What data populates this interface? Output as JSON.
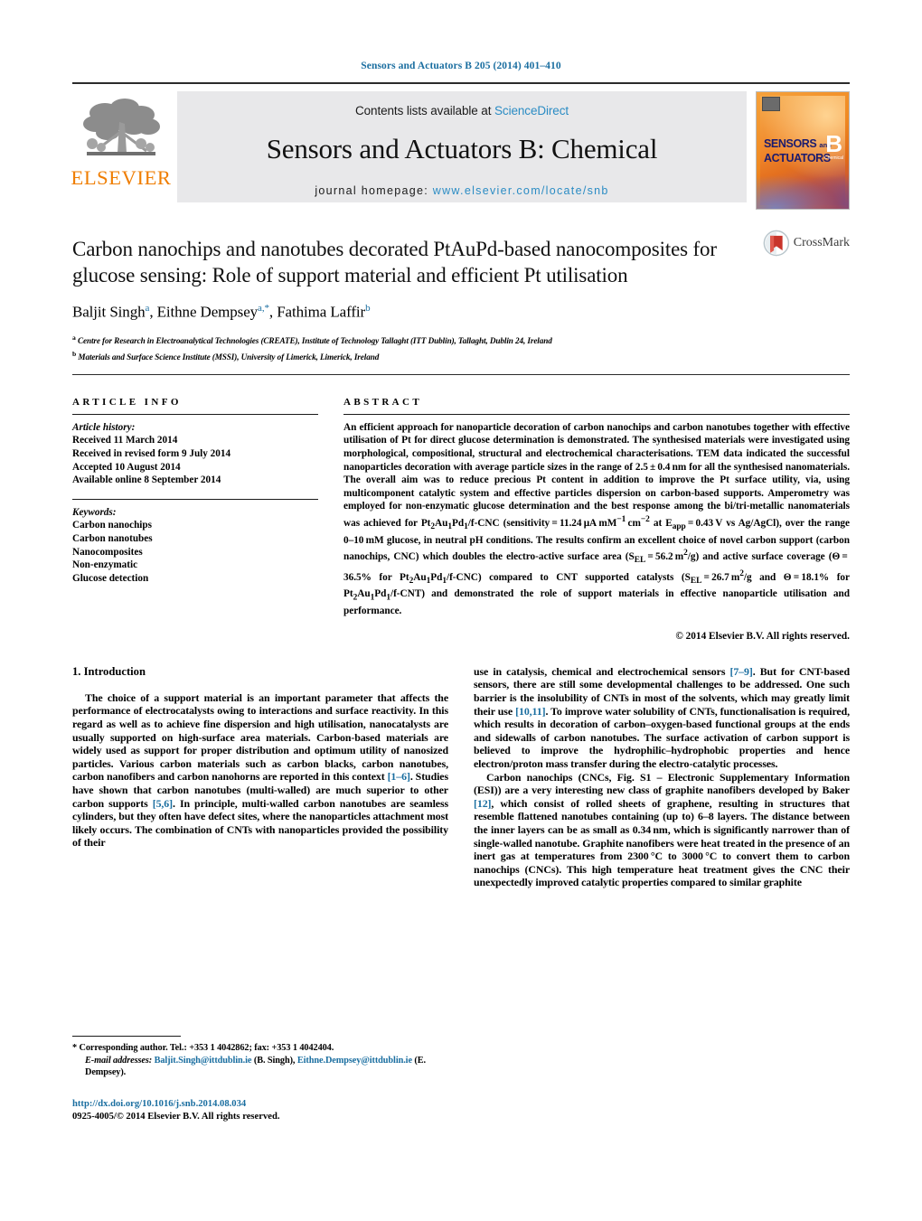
{
  "running_head": "Sensors and Actuators B 205 (2014) 401–410",
  "masthead": {
    "publisher_name": "ELSEVIER",
    "contents_prefix": "Contents lists available at ",
    "contents_link": "ScienceDirect",
    "journal_title": "Sensors and Actuators B: Chemical",
    "homepage_label": "journal homepage:",
    "homepage_url": "www.elsevier.com/locate/snb",
    "cover": {
      "line1": "SENSORS",
      "line1_small": "and",
      "line2": "ACTUATORS",
      "letter": "B",
      "sub": "Chemical"
    }
  },
  "article": {
    "title": "Carbon nanochips and nanotubes decorated PtAuPd-based nanocomposites for glucose sensing: Role of support material and efficient Pt utilisation",
    "crossmark_label": "CrossMark",
    "authors_html": "Baljit Singh<sup>a</sup>, Eithne Dempsey<sup>a,*</sup>, Fathima Laffir<sup>b</sup>",
    "affiliations": [
      "a Centre for Research in Electroanalytical Technologies (CREATE), Institute of Technology Tallaght (ITT Dublin), Tallaght, Dublin 24, Ireland",
      "b Materials and Surface Science Institute (MSSI), University of Limerick, Limerick, Ireland"
    ]
  },
  "article_info": {
    "heading": "ARTICLE INFO",
    "history_label": "Article history:",
    "history": [
      "Received 11 March 2014",
      "Received in revised form 9 July 2014",
      "Accepted 10 August 2014",
      "Available online 8 September 2014"
    ],
    "keywords_label": "Keywords:",
    "keywords": [
      "Carbon nanochips",
      "Carbon nanotubes",
      "Nanocomposites",
      "Non-enzymatic",
      "Glucose detection"
    ]
  },
  "abstract": {
    "heading": "ABSTRACT",
    "text_html": "An efficient approach for nanoparticle decoration of carbon nanochips and carbon nanotubes together with effective utilisation of Pt for direct glucose determination is demonstrated. The synthesised materials were investigated using morphological, compositional, structural and electrochemical characterisations. TEM data indicated the successful nanoparticles decoration with average particle sizes in the range of 2.5 ± 0.4 nm for all the synthesised nanomaterials. The overall aim was to reduce precious Pt content in addition to improve the Pt surface utility, via, using multicomponent catalytic system and effective particles dispersion on carbon-based supports. Amperometry was employed for non-enzymatic glucose determination and the best response among the bi/tri-metallic nanomaterials was achieved for Pt<sub>2</sub>Au<sub>1</sub>Pd<sub>1</sub>/f-CNC (sensitivity = 11.24 μA mM<sup>−1</sup> cm<sup>−2</sup> at E<sub>app</sub> = 0.43 V vs Ag/AgCl), over the range 0–10 mM glucose, in neutral pH conditions. The results confirm an excellent choice of novel carbon support (carbon nanochips, CNC) which doubles the electro-active surface area (S<sub>EL</sub> = 56.2 m<sup>2</sup>/g) and active surface coverage (Θ = 36.5% for Pt<sub>2</sub>Au<sub>1</sub>Pd<sub>1</sub>/f-CNC) compared to CNT supported catalysts (S<sub>EL</sub> = 26.7 m<sup>2</sup>/g and Θ = 18.1% for Pt<sub>2</sub>Au<sub>1</sub>Pd<sub>1</sub>/f-CNT) and demonstrated the role of support materials in effective nanoparticle utilisation and performance.",
    "copyright": "© 2014 Elsevier B.V. All rights reserved."
  },
  "body": {
    "section_heading": "1.  Introduction",
    "left_paragraphs_html": [
      "The choice of a support material is an important parameter that affects the performance of electrocatalysts owing to interactions and surface reactivity. In this regard as well as to achieve fine dispersion and high utilisation, nanocatalysts are usually supported on high-surface area materials. Carbon-based materials are widely used as support for proper distribution and optimum utility of nanosized particles. Various carbon materials such as carbon blacks, carbon nanotubes, carbon nanofibers and carbon nanohorns are reported in this context <span class=\"ref\">[1–6]</span>. Studies have shown that carbon nanotubes (multi-walled) are much superior to other carbon supports <span class=\"ref\">[5,6]</span>. In principle, multi-walled carbon nanotubes are seamless cylinders, but they often have defect sites, where the nanoparticles attachment most likely occurs. The combination of CNTs with nanoparticles provided the possibility of their"
    ],
    "right_paragraphs_html": [
      "use in catalysis, chemical and electrochemical sensors <span class=\"ref\">[7–9]</span>. But for CNT-based sensors, there are still some developmental challenges to be addressed. One such barrier is the insolubility of CNTs in most of the solvents, which may greatly limit their use <span class=\"ref\">[10,11]</span>. To improve water solubility of CNTs, functionalisation is required, which results in decoration of carbon–oxygen-based functional groups at the ends and sidewalls of carbon nanotubes. The surface activation of carbon support is believed to improve the hydrophilic–hydrophobic properties and hence electron/proton mass transfer during the electro-catalytic processes.",
      "Carbon nanochips (CNCs, Fig. S1 – Electronic Supplementary Information (ESI)) are a very interesting new class of graphite nanofibers developed by Baker <span class=\"ref\">[12]</span>, which consist of rolled sheets of graphene, resulting in structures that resemble flattened nanotubes containing (up to) 6–8 layers. The distance between the inner layers can be as small as 0.34 nm, which is significantly narrower than of single-walled nanotube. Graphite nanofibers were heat treated in the presence of an inert gas at temperatures from 2300 °C to 3000 °C to convert them to carbon nanochips (CNCs). This high temperature heat treatment gives the CNC their unexpectedly improved catalytic properties compared to similar graphite"
    ]
  },
  "footnotes": {
    "corresponding_html": "<span style=\"font-weight:bold\">*</span> Corresponding author. Tel.: +353 1 4042862; fax: +353 1 4042404.",
    "email_label": "E-mail addresses:",
    "emails_html": "<a class=\"lnk\" href=\"#\">Baljit.Singh@ittdublin.ie</a> (B. Singh), <a class=\"lnk\" href=\"#\">Eithne.Dempsey@ittdublin.ie</a> (E. Dempsey).",
    "doi_url": "http://dx.doi.org/10.1016/j.snb.2014.08.034",
    "issn_line": "0925-4005/© 2014 Elsevier B.V. All rights reserved."
  },
  "colors": {
    "link": "#1a6ea0",
    "elsevier_orange": "#ef7d00",
    "band_gray": "#e8e8ea"
  }
}
